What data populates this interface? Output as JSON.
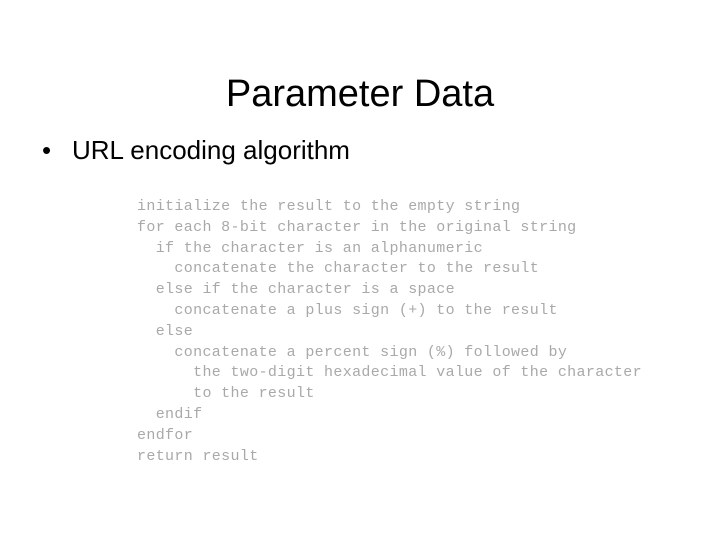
{
  "slide": {
    "title": "Parameter Data",
    "background_color": "#ffffff",
    "title_color": "#000000",
    "body_text_color": "#000000",
    "code_text_color": "#a9a9a9"
  },
  "bullets": [
    {
      "marker": "•",
      "label": "URL encoding algorithm"
    }
  ],
  "code": {
    "lines": [
      "initialize the result to the empty string",
      "for each 8-bit character in the original string",
      "  if the character is an alphanumeric",
      "    concatenate the character to the result",
      "  else if the character is a space",
      "    concatenate a plus sign (+) to the result",
      "  else",
      "    concatenate a percent sign (%) followed by",
      "      the two-digit hexadecimal value of the character",
      "      to the result",
      "  endif",
      "endfor",
      "return result"
    ]
  }
}
